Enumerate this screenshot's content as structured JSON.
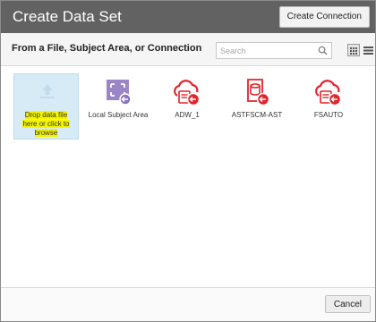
{
  "dialog": {
    "title": "Create Data Set",
    "create_connection_label": "Create Connection"
  },
  "toolbar": {
    "heading": "From a File, Subject Area, or Connection",
    "search_placeholder": "Search",
    "search_icon": "magnifier-icon",
    "view_grid_icon": "grid-view-icon",
    "view_list_icon": "list-view-icon"
  },
  "sources": {
    "drop": {
      "line1": "Drop data file",
      "line2": "here or click to",
      "line3": "browse",
      "icon": "upload-arrow-icon"
    },
    "items": [
      {
        "label": "Local Subject Area",
        "icon": "subject-area-icon",
        "color": "#8a72b8"
      },
      {
        "label": "ADW_1",
        "icon": "cloud-connection-icon",
        "color": "#e2232a"
      },
      {
        "label": "ASTFSCM-AST",
        "icon": "database-connection-icon",
        "color": "#e2232a"
      },
      {
        "label": "FSAUTO",
        "icon": "cloud-connection-icon",
        "color": "#e2232a"
      }
    ]
  },
  "footer": {
    "cancel_label": "Cancel"
  }
}
